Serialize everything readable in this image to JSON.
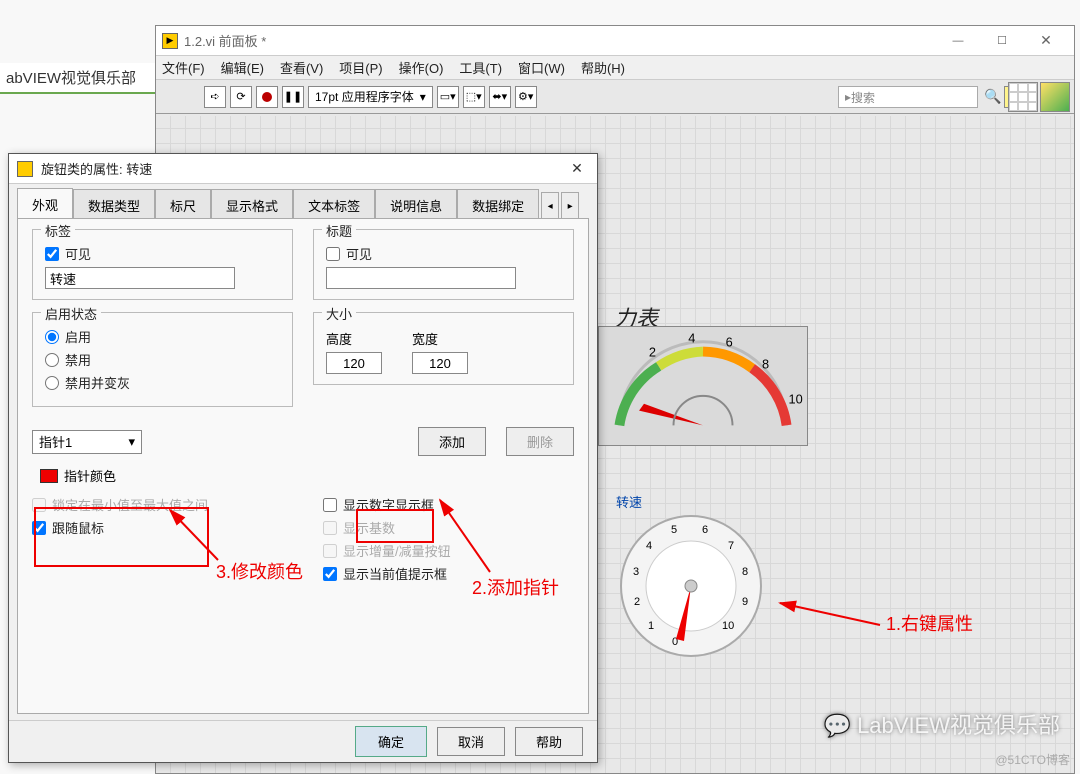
{
  "bg_tab": "abVIEW视觉俱乐部",
  "main": {
    "title": "1.2.vi 前面板 *",
    "menu": [
      "文件(F)",
      "编辑(E)",
      "查看(V)",
      "项目(P)",
      "操作(O)",
      "工具(T)",
      "窗口(W)",
      "帮助(H)"
    ],
    "font": "17pt 应用程序字体",
    "search_placeholder": "搜索"
  },
  "gauge1_title": "力表",
  "speed_label": "转速",
  "dialog": {
    "title": "旋钮类的属性: 转速",
    "tabs": [
      "外观",
      "数据类型",
      "标尺",
      "显示格式",
      "文本标签",
      "说明信息",
      "数据绑定"
    ],
    "label_group": "标签",
    "visible": "可见",
    "label_value": "转速",
    "title_group": "标题",
    "title_value": "",
    "enable_group": "启用状态",
    "enable_opts": [
      "启用",
      "禁用",
      "禁用并变灰"
    ],
    "size_group": "大小",
    "height_lbl": "高度",
    "width_lbl": "宽度",
    "height": "120",
    "width": "120",
    "pointer_sel": "指针1",
    "add_btn": "添加",
    "del_btn": "删除",
    "ptr_color": "指针颜色",
    "opt_lock": "锁定在最小值至最大值之间",
    "opt_follow": "跟随鼠标",
    "opt_digital": "显示数字显示框",
    "opt_base": "显示基数",
    "opt_incdec": "显示增量/减量按钮",
    "opt_current": "显示当前值提示框",
    "ok": "确定",
    "cancel": "取消",
    "help": "帮助"
  },
  "annotations": {
    "a1": "1.右键属性",
    "a2": "2.添加指针",
    "a3": "3.修改颜色"
  },
  "watermark1": "@51CTO博客",
  "watermark2": "LabVIEW视觉俱乐部",
  "chart_data": [
    {
      "type": "gauge",
      "title": "力表",
      "range": [
        0,
        10
      ],
      "ticks": [
        2,
        4,
        6,
        8,
        10
      ],
      "value": 1.2,
      "color_zones": [
        {
          "from": 0,
          "to": 3,
          "color": "#4caf50"
        },
        {
          "from": 3,
          "to": 5,
          "color": "#cddc39"
        },
        {
          "from": 5,
          "to": 7.5,
          "color": "#ff9800"
        },
        {
          "from": 7.5,
          "to": 10,
          "color": "#e53935"
        }
      ]
    },
    {
      "type": "dial",
      "title": "转速",
      "range": [
        0,
        10
      ],
      "ticks": [
        0,
        1,
        2,
        3,
        4,
        5,
        6,
        7,
        8,
        9,
        10
      ],
      "value": 0
    }
  ]
}
